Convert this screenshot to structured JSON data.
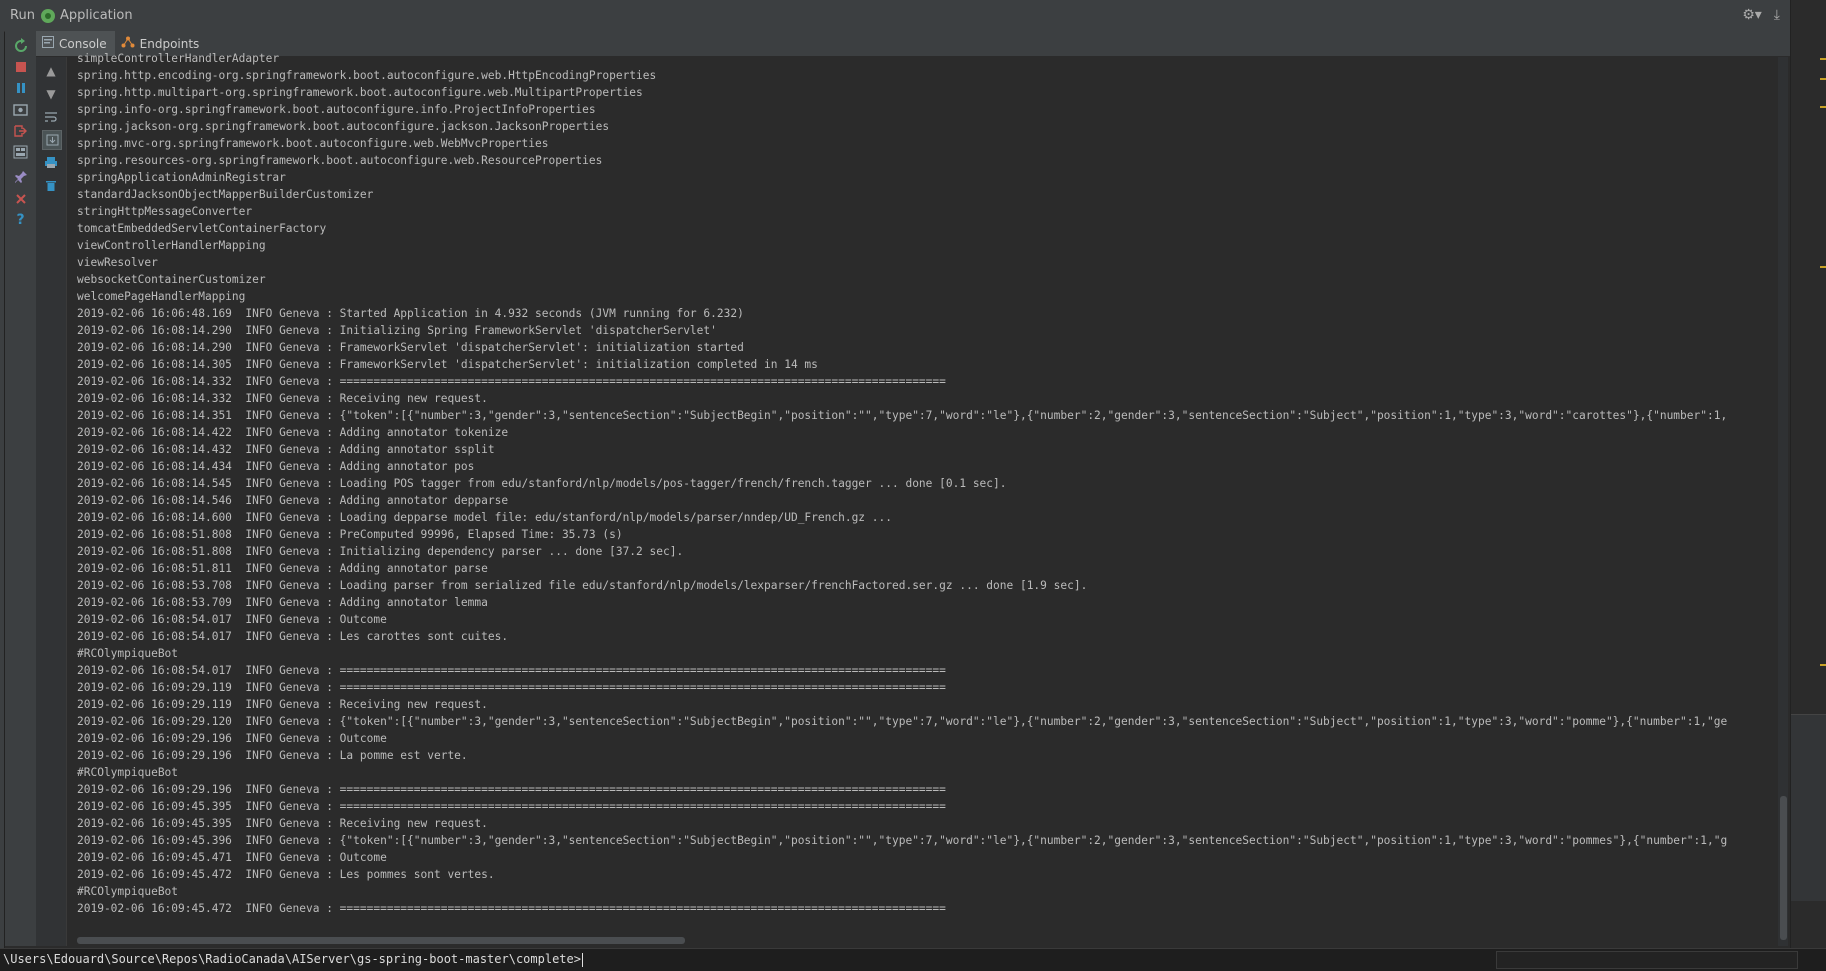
{
  "header": {
    "run_label": "Run",
    "app_name": "Application",
    "app_icon": "spring-boot-app-icon",
    "settings_icon": "gear-icon",
    "minimize_icon": "hide-icon"
  },
  "tabs": [
    {
      "label": "Console",
      "icon": "console-icon",
      "active": true
    },
    {
      "label": "Endpoints",
      "icon": "endpoints-icon",
      "active": false
    }
  ],
  "toolbar_icons": [
    "rerun-icon",
    "stop-icon",
    "pause-icon",
    "dump-threads-icon",
    "exit-icon",
    "layout-icon",
    "pin-icon",
    "close-icon",
    "help-icon"
  ],
  "gutter_icons": [
    "up-arrow-icon",
    "down-arrow-icon",
    "soft-wrap-icon",
    "scroll-to-end-icon",
    "print-icon",
    "trash-icon"
  ],
  "console_lines": [
    "simpleControllerHandlerAdapter",
    "spring.http.encoding-org.springframework.boot.autoconfigure.web.HttpEncodingProperties",
    "spring.http.multipart-org.springframework.boot.autoconfigure.web.MultipartProperties",
    "spring.info-org.springframework.boot.autoconfigure.info.ProjectInfoProperties",
    "spring.jackson-org.springframework.boot.autoconfigure.jackson.JacksonProperties",
    "spring.mvc-org.springframework.boot.autoconfigure.web.WebMvcProperties",
    "spring.resources-org.springframework.boot.autoconfigure.web.ResourceProperties",
    "springApplicationAdminRegistrar",
    "standardJacksonObjectMapperBuilderCustomizer",
    "stringHttpMessageConverter",
    "tomcatEmbeddedServletContainerFactory",
    "viewControllerHandlerMapping",
    "viewResolver",
    "websocketContainerCustomizer",
    "welcomePageHandlerMapping",
    "2019-02-06 16:06:48.169  INFO Geneva : Started Application in 4.932 seconds (JVM running for 6.232)",
    "2019-02-06 16:08:14.290  INFO Geneva : Initializing Spring FrameworkServlet 'dispatcherServlet'",
    "2019-02-06 16:08:14.290  INFO Geneva : FrameworkServlet 'dispatcherServlet': initialization started",
    "2019-02-06 16:08:14.305  INFO Geneva : FrameworkServlet 'dispatcherServlet': initialization completed in 14 ms",
    "2019-02-06 16:08:14.332  INFO Geneva : ==========================================================================================",
    "2019-02-06 16:08:14.332  INFO Geneva : Receiving new request.",
    "2019-02-06 16:08:14.351  INFO Geneva : {\"token\":[{\"number\":3,\"gender\":3,\"sentenceSection\":\"SubjectBegin\",\"position\":\"\",\"type\":7,\"word\":\"le\"},{\"number\":2,\"gender\":3,\"sentenceSection\":\"Subject\",\"position\":1,\"type\":3,\"word\":\"carottes\"},{\"number\":1,",
    "2019-02-06 16:08:14.422  INFO Geneva : Adding annotator tokenize",
    "2019-02-06 16:08:14.432  INFO Geneva : Adding annotator ssplit",
    "2019-02-06 16:08:14.434  INFO Geneva : Adding annotator pos",
    "2019-02-06 16:08:14.545  INFO Geneva : Loading POS tagger from edu/stanford/nlp/models/pos-tagger/french/french.tagger ... done [0.1 sec].",
    "2019-02-06 16:08:14.546  INFO Geneva : Adding annotator depparse",
    "2019-02-06 16:08:14.600  INFO Geneva : Loading depparse model file: edu/stanford/nlp/models/parser/nndep/UD_French.gz ...",
    "2019-02-06 16:08:51.808  INFO Geneva : PreComputed 99996, Elapsed Time: 35.73 (s)",
    "2019-02-06 16:08:51.808  INFO Geneva : Initializing dependency parser ... done [37.2 sec].",
    "2019-02-06 16:08:51.811  INFO Geneva : Adding annotator parse",
    "2019-02-06 16:08:53.708  INFO Geneva : Loading parser from serialized file edu/stanford/nlp/models/lexparser/frenchFactored.ser.gz ... done [1.9 sec].",
    "2019-02-06 16:08:53.709  INFO Geneva : Adding annotator lemma",
    "2019-02-06 16:08:54.017  INFO Geneva : Outcome",
    "2019-02-06 16:08:54.017  INFO Geneva : Les carottes sont cuites.",
    "#RCOlympiqueBot",
    "2019-02-06 16:08:54.017  INFO Geneva : ==========================================================================================",
    "2019-02-06 16:09:29.119  INFO Geneva : ==========================================================================================",
    "2019-02-06 16:09:29.119  INFO Geneva : Receiving new request.",
    "2019-02-06 16:09:29.120  INFO Geneva : {\"token\":[{\"number\":3,\"gender\":3,\"sentenceSection\":\"SubjectBegin\",\"position\":\"\",\"type\":7,\"word\":\"le\"},{\"number\":2,\"gender\":3,\"sentenceSection\":\"Subject\",\"position\":1,\"type\":3,\"word\":\"pomme\"},{\"number\":1,\"ge",
    "2019-02-06 16:09:29.196  INFO Geneva : Outcome",
    "2019-02-06 16:09:29.196  INFO Geneva : La pomme est verte.",
    "#RCOlympiqueBot",
    "2019-02-06 16:09:29.196  INFO Geneva : ==========================================================================================",
    "2019-02-06 16:09:45.395  INFO Geneva : ==========================================================================================",
    "2019-02-06 16:09:45.395  INFO Geneva : Receiving new request.",
    "2019-02-06 16:09:45.396  INFO Geneva : {\"token\":[{\"number\":3,\"gender\":3,\"sentenceSection\":\"SubjectBegin\",\"position\":\"\",\"type\":7,\"word\":\"le\"},{\"number\":2,\"gender\":3,\"sentenceSection\":\"Subject\",\"position\":1,\"type\":3,\"word\":\"pommes\"},{\"number\":1,\"g",
    "2019-02-06 16:09:45.471  INFO Geneva : Outcome",
    "2019-02-06 16:09:45.472  INFO Geneva : Les pommes sont vertes.",
    "#RCOlympiqueBot",
    "2019-02-06 16:09:45.472  INFO Geneva : =========================================================================================="
  ],
  "command_line": {
    "path": "\\Users\\Edouard\\Source\\Repos\\RadioCanada\\AIServer\\gs-spring-boot-master\\complete>"
  },
  "colors": {
    "background": "#2b2b2b",
    "panel": "#3c3f41",
    "text": "#bbbbbb",
    "rerun_green": "#59a869",
    "stop_red": "#c75450",
    "pause_blue": "#3592c4"
  }
}
